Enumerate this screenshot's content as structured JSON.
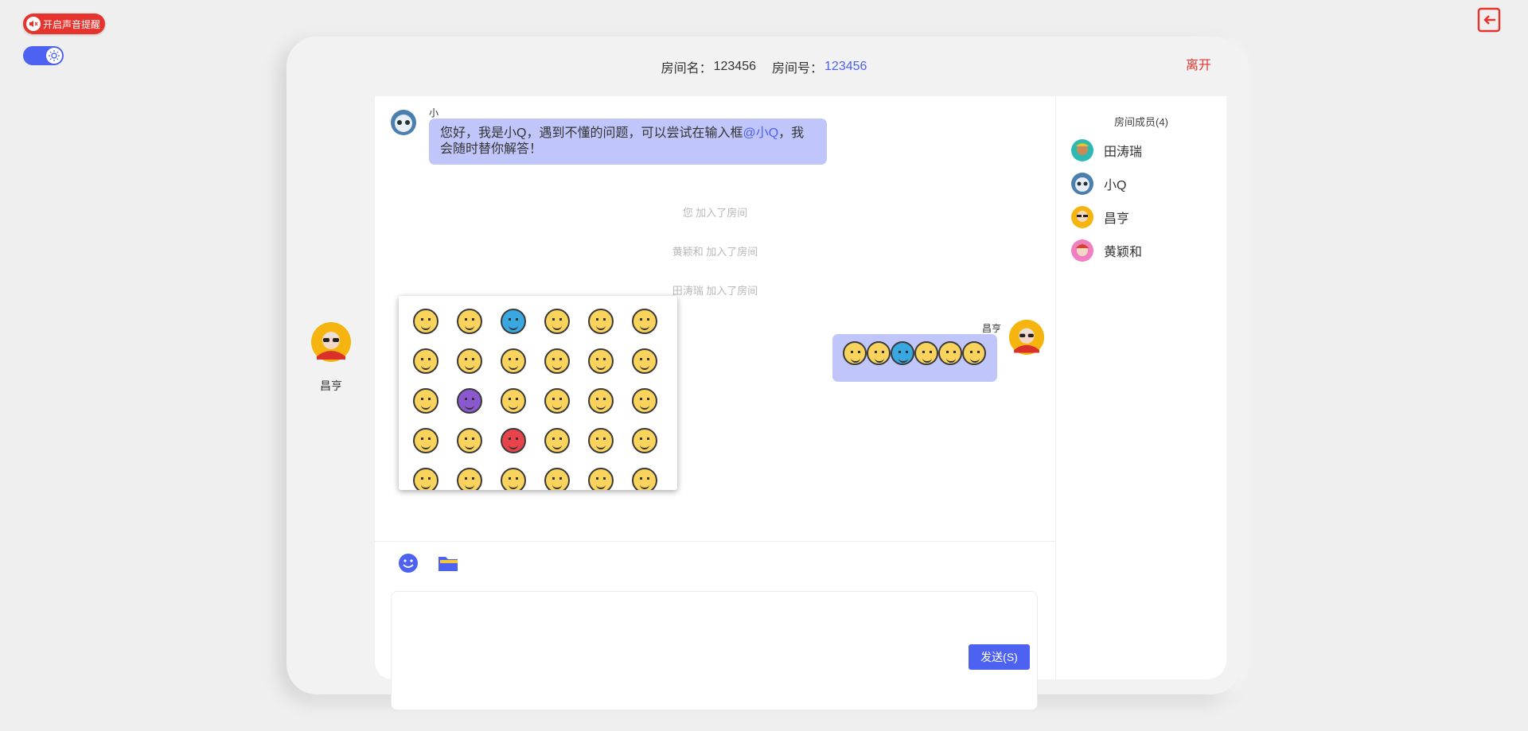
{
  "top_controls": {
    "sound_label": "开启声音提醒"
  },
  "room": {
    "name_label": "房间名：",
    "name": "123456",
    "id_label": "房间号：",
    "id": "123456",
    "leave_label": "离开"
  },
  "current_user": {
    "name": "昌亨"
  },
  "messages": [
    {
      "sender": "小Q",
      "text_before": "您好，我是小Q，遇到不懂的问题，可以尝试在输入框",
      "mention": "@小Q",
      "text_after": "，我会随时替你解答！"
    },
    {
      "sender": "昌亨",
      "emoji_count": "6"
    }
  ],
  "system_messages": [
    "您 加入了房间",
    "黄颖和 加入了房间",
    "田涛瑞 加入了房间"
  ],
  "members": {
    "title": "房间成员(4)",
    "list": [
      "田涛瑞",
      "小Q",
      "昌亨",
      "黄颖和"
    ]
  },
  "composer": {
    "send_label": "发送(S)"
  },
  "icons": {
    "sound": "speaker-muted-icon",
    "theme": "sun-icon",
    "exit": "exit-icon",
    "emoji": "smiley-icon",
    "file": "folder-icon"
  },
  "colors": {
    "accent": "#4d62f0",
    "danger": "#e7332d",
    "bubble": "#c0c6fa",
    "emoji_yellow": "#f9d35c"
  }
}
